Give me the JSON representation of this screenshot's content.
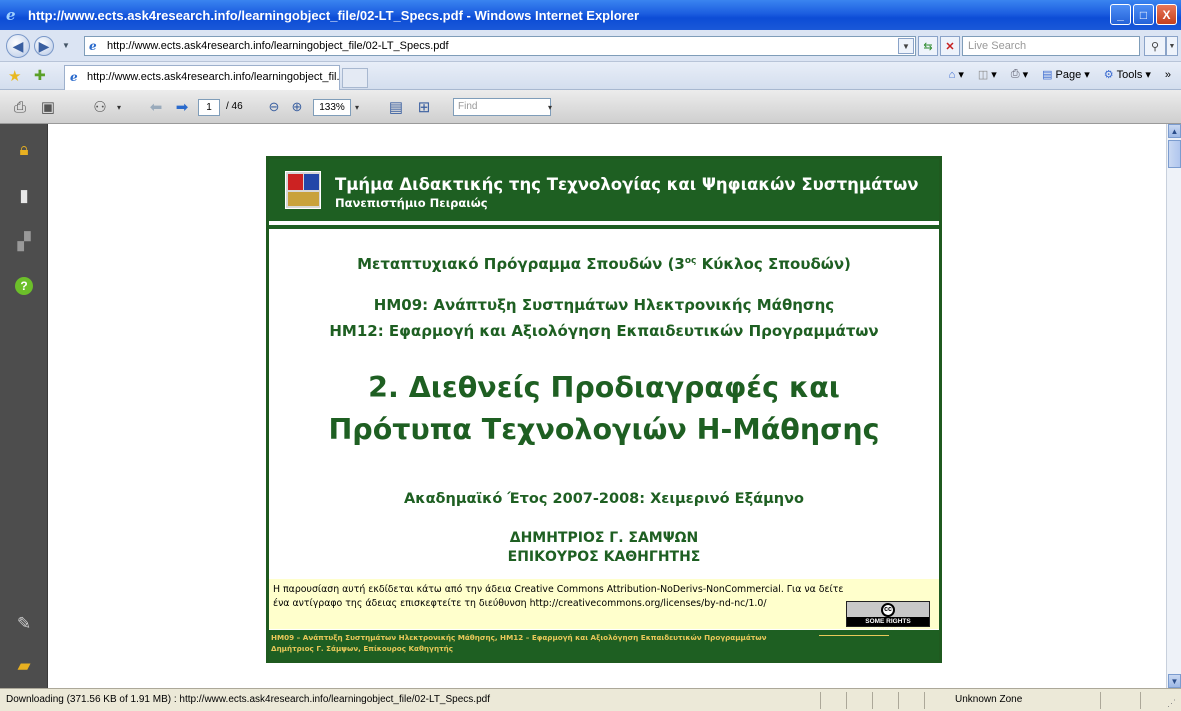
{
  "window": {
    "title": "http://www.ects.ask4research.info/learningobject_file/02-LT_Specs.pdf - Windows Internet Explorer",
    "minimize": "_",
    "maximize": "□",
    "close": "X"
  },
  "address_bar": {
    "url": "http://www.ects.ask4research.info/learningobject_file/02-LT_Specs.pdf",
    "search_placeholder": "Live Search"
  },
  "tabs": {
    "active_label": "http://www.ects.ask4research.info/learningobject_fil..."
  },
  "command_bar": {
    "page_label": "Page",
    "tools_label": "Tools"
  },
  "pdf_toolbar": {
    "current_page": "1",
    "page_total": "/ 46",
    "zoom": "133%",
    "find_placeholder": "Find"
  },
  "slide": {
    "header_title": "Τμήμα Διδακτικής της Τεχνολογίας και Ψηφιακών Συστημάτων",
    "header_subtitle": "Πανεπιστήμιο Πειραιώς",
    "program_prefix": "Μεταπτυχιακό Πρόγραμμα Σπουδών (3",
    "program_sup": "ος",
    "program_suffix": " Κύκλος Σπουδών)",
    "course1": "ΗΜ09: Ανάπτυξη Συστημάτων Ηλεκτρονικής Μάθησης",
    "course2": "ΗΜ12: Εφαρμογή και Αξιολόγηση Εκπαιδευτικών Προγραμμάτων",
    "main_title_line1": "2. Διεθνείς Προδιαγραφές και",
    "main_title_line2": "Πρότυπα Τεχνολογιών Η-Μάθησης",
    "academic_year": "Ακαδημαϊκό Έτος 2007-2008: Χειμερινό Εξάμηνο",
    "author_name": "ΔΗΜΗΤΡΙΟΣ Γ. ΣΑΜΨΩΝ",
    "author_title": "ΕΠΙΚΟΥΡΟΣ ΚΑΘΗΓΗΤΗΣ",
    "license_line1": "Η παρουσίαση αυτή εκδίδεται κάτω από την άδεια Creative Commons Attribution-NoDerivs-NonCommercial. Για να δείτε",
    "license_line2": "ένα αντίγραφο της άδειας επισκεφτείτε τη διεύθυνση http://creativecommons.org/licenses/by-nd-nc/1.0/",
    "cc_badge_text": "SOME RIGHTS RESERVED",
    "cc_symbol": "cc",
    "footer_line1": "ΗΜ09 – Ανάπτυξη Συστημάτων Ηλεκτρονικής Μάθησης, ΗΜ12 – Εφαρμογή και Αξιολόγηση Εκπαιδευτικών Προγραμμάτων",
    "footer_line2": "Δημήτριος Γ. Σάμψων, Επίκουρος Καθηγητής"
  },
  "status_bar": {
    "text": "Downloading (371.56 KB of 1.91 MB) : http://www.ects.ask4research.info/learningobject_file/02-LT_Specs.pdf",
    "zone": "Unknown Zone"
  },
  "colors": {
    "slide_green": "#1e5f22",
    "footer_gold": "#e8c85a",
    "license_bg": "#ffffcc"
  }
}
